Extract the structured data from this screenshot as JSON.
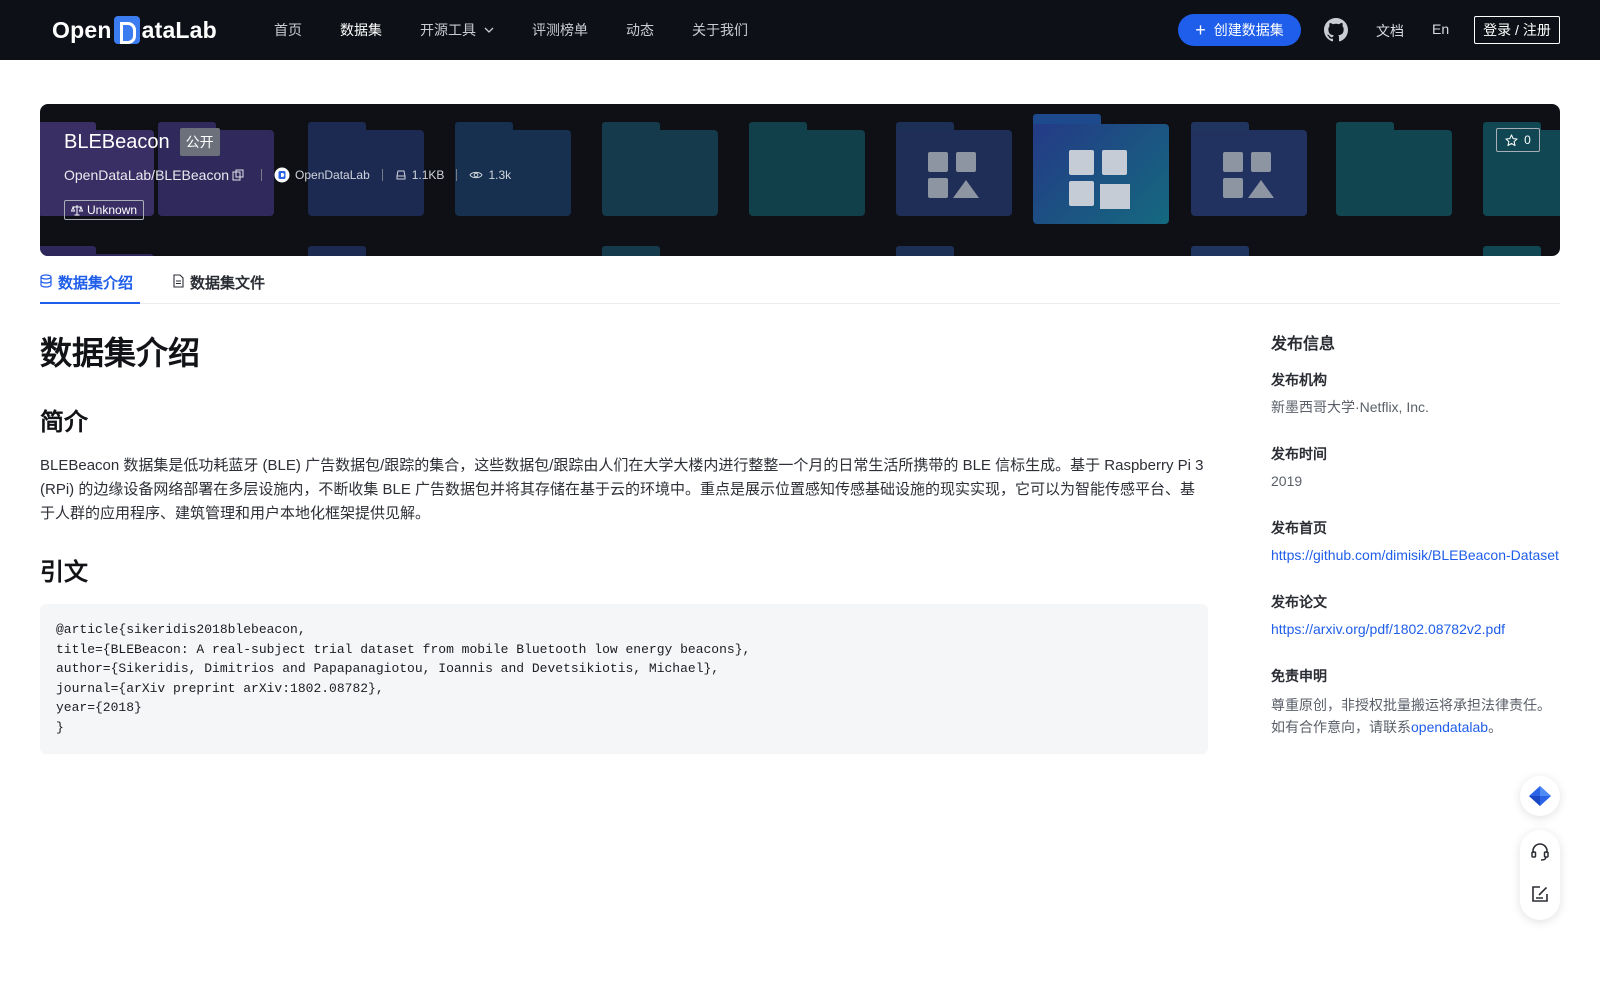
{
  "header": {
    "logo_text_left": "Open",
    "logo_text_right": "ataLab",
    "nav": [
      {
        "label": "首页",
        "active": false
      },
      {
        "label": "数据集",
        "active": true
      },
      {
        "label": "开源工具",
        "active": false,
        "dropdown": true
      },
      {
        "label": "评测榜单",
        "active": false
      },
      {
        "label": "动态",
        "active": false
      },
      {
        "label": "关于我们",
        "active": false
      }
    ],
    "create_button": "创建数据集",
    "docs": "文档",
    "lang": "En",
    "login": "登录 / 注册"
  },
  "banner": {
    "title": "BLEBeacon",
    "visibility": "公开",
    "path": "OpenDataLab/BLEBeacon",
    "publisher": "OpenDataLab",
    "size": "1.1KB",
    "views": "1.3k",
    "license": "Unknown",
    "stars": "0"
  },
  "tabs": [
    {
      "label": "数据集介绍",
      "active": true
    },
    {
      "label": "数据集文件",
      "active": false
    }
  ],
  "content": {
    "heading": "数据集介绍",
    "intro_heading": "简介",
    "intro_text": "BLEBeacon 数据集是低功耗蓝牙 (BLE) 广告数据包/跟踪的集合，这些数据包/跟踪由人们在大学大楼内进行整整一个月的日常生活所携带的 BLE 信标生成。基于 Raspberry Pi 3 (RPi) 的边缘设备网络部署在多层设施内，不断收集 BLE 广告数据包并将其存储在基于云的环境中。重点是展示位置感知传感基础设施的现实实现，它可以为智能传感平台、基于人群的应用程序、建筑管理和用户本地化框架提供见解。",
    "citation_heading": "引文",
    "citation_code": "@article{sikeridis2018blebeacon,\ntitle={BLEBeacon: A real-subject trial dataset from mobile Bluetooth low energy beacons},\nauthor={Sikeridis, Dimitrios and Papapanagiotou, Ioannis and Devetsikiotis, Michael},\njournal={arXiv preprint arXiv:1802.08782},\nyear={2018}\n}"
  },
  "sidebar": {
    "title": "发布信息",
    "org_label": "发布机构",
    "org_value": "新墨西哥大学·Netflix, Inc.",
    "date_label": "发布时间",
    "date_value": "2019",
    "home_label": "发布首页",
    "home_link": "https://github.com/dimisik/BLEBeacon-Dataset",
    "paper_label": "发布论文",
    "paper_link": "https://arxiv.org/pdf/1802.08782v2.pdf",
    "disclaimer_label": "免责申明",
    "disclaimer_line1": "尊重原创，非授权批量搬运将承担法律责任。",
    "disclaimer_line2_prefix": "如有合作意向，请联系",
    "disclaimer_line2_link": "opendatalab",
    "disclaimer_line2_suffix": "。"
  },
  "colors": {
    "header_bg": "#0d1117",
    "accent": "#1f5eea",
    "banner_bg": "#0f1016"
  },
  "icons": [
    "chevron-down-icon",
    "plus-icon",
    "github-icon",
    "copy-icon",
    "hard-disk-icon",
    "eye-icon",
    "scale-icon",
    "star-icon",
    "database-icon",
    "file-icon",
    "logo-icon",
    "headset-icon",
    "edit-icon"
  ]
}
